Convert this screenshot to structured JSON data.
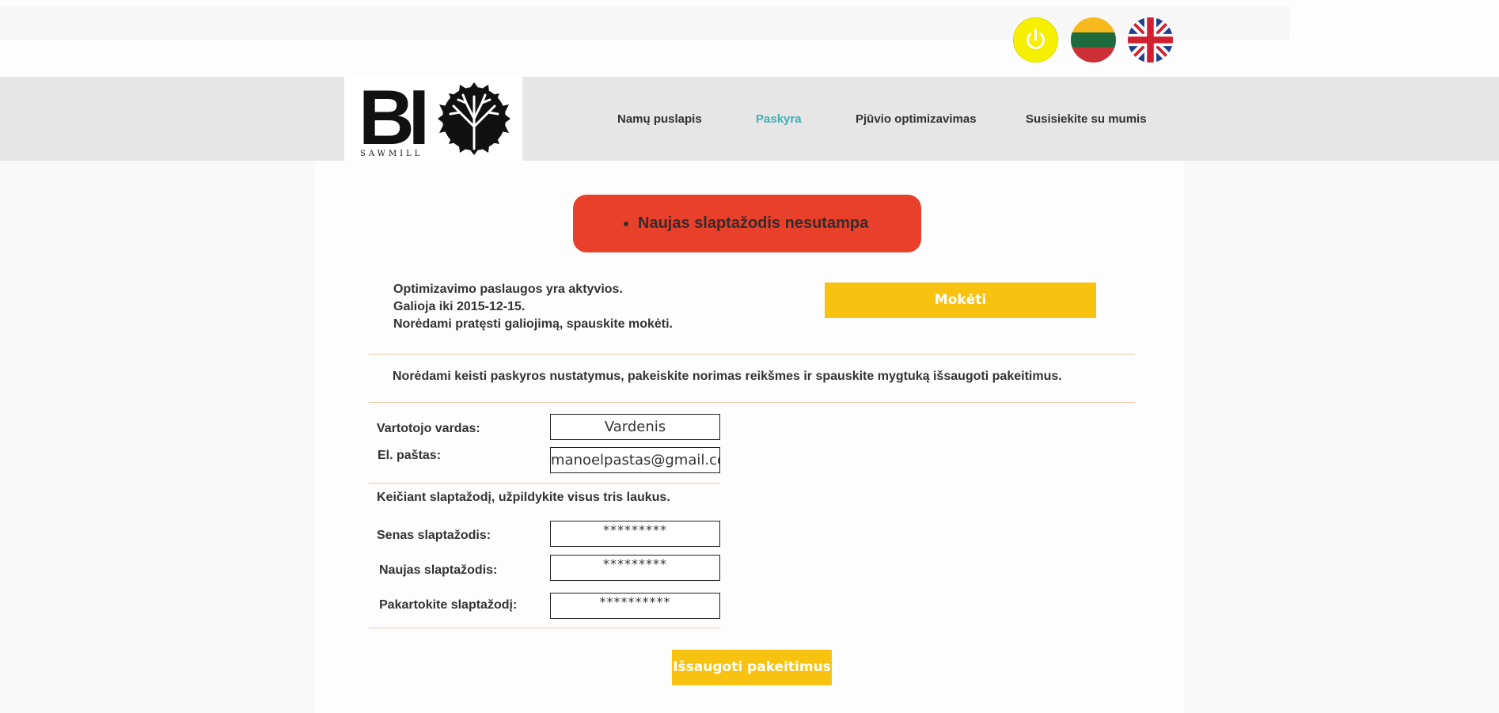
{
  "header": {
    "power_icon": "power-icon",
    "languages": [
      {
        "name": "lithuanian-flag-icon"
      },
      {
        "name": "uk-flag-icon"
      }
    ]
  },
  "logo": {
    "text": "BI",
    "subtitle": "SAWMILL",
    "icon": "sawblade-tree-icon"
  },
  "nav": {
    "items": [
      {
        "label": "Namų puslapis"
      },
      {
        "label": "Paskyra"
      },
      {
        "label": "Pjūvio optimizavimas"
      },
      {
        "label": "Susisiekite su mumis"
      }
    ],
    "active_color": "#3fb0b5"
  },
  "error": {
    "message": "Naujas slaptažodis nesutampa",
    "color": "#e8402a"
  },
  "subscription": {
    "line1": "Optimizavimo paslaugos yra aktyvios.",
    "line2": "Galioja iki 2015-12-15.",
    "line3": "Norėdami pratęsti galiojimą, spauskite mokėti.",
    "pay_label": "Mokėti"
  },
  "instruction": "Norėdami keisti paskyros nustatymus, pakeiskite norimas reikšmes ir spauskite mygtuką išsaugoti pakeitimus.",
  "form": {
    "username_label": "Vartotojo vardas:",
    "username_value": "Vardenis",
    "email_label": "El. paštas:",
    "email_value": "manoelpastas@gmail.com",
    "password_hint": "Keičiant slaptažodį, užpildykite visus tris laukus.",
    "old_pw_label": "Senas slaptažodis:",
    "old_pw_value": "*********",
    "new_pw_label": "Naujas slaptažodis:",
    "new_pw_value": "*********",
    "repeat_pw_label": "Pakartokite slaptažodį:",
    "repeat_pw_value": "**********",
    "save_label": "Išsaugoti pakeitimus"
  },
  "accent": "#f7c310"
}
